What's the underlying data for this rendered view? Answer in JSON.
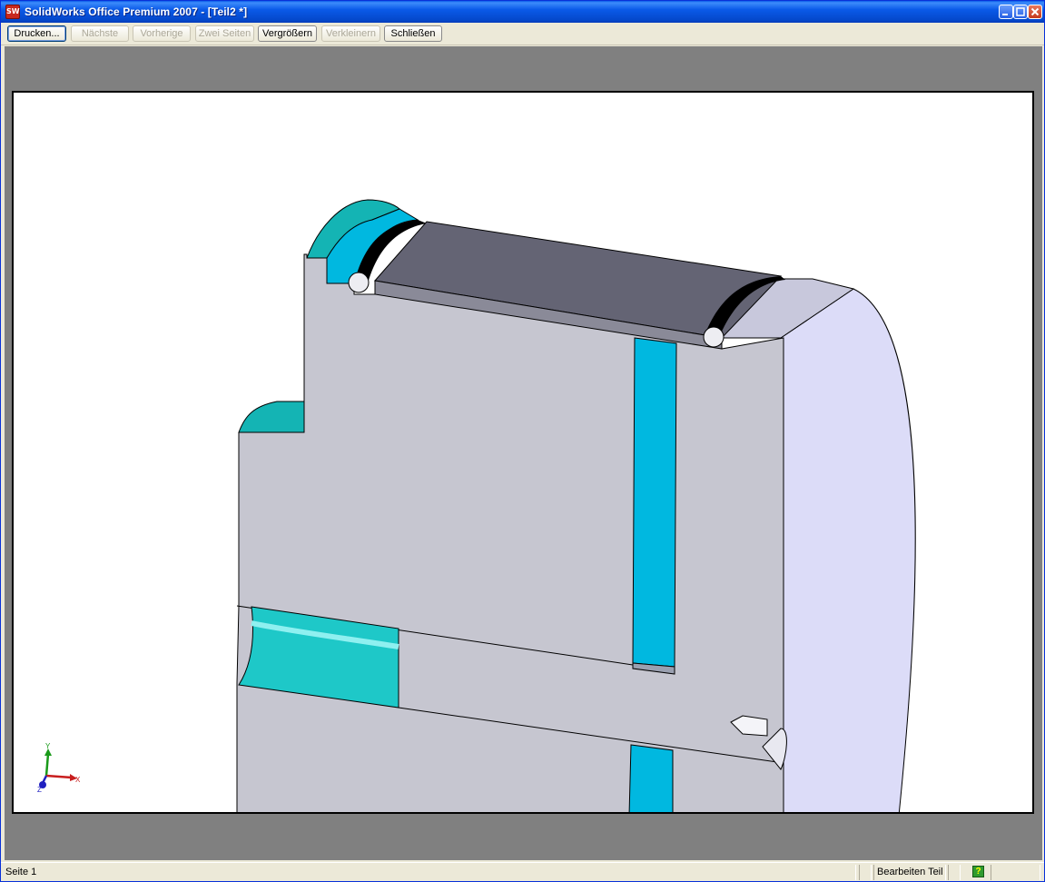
{
  "window": {
    "title": "SolidWorks Office Premium 2007 - [Teil2 *]",
    "app_icon_text": "SW"
  },
  "toolbar": {
    "buttons": [
      {
        "label": "Drucken...",
        "enabled": true,
        "focused": true
      },
      {
        "label": "Nächste",
        "enabled": false
      },
      {
        "label": "Vorherige",
        "enabled": false
      },
      {
        "label": "Zwei Seiten",
        "enabled": false
      },
      {
        "label": "Vergrößern",
        "enabled": true
      },
      {
        "label": "Verkleinern",
        "enabled": false
      },
      {
        "label": "Schließen",
        "enabled": true
      }
    ]
  },
  "triad": {
    "x_label": "X",
    "y_label": "Y",
    "z_label": "Z"
  },
  "statusbar": {
    "page": "Seite 1",
    "mode": "Bearbeiten Teil",
    "help_symbol": "?"
  },
  "colors": {
    "face_gray": "#c6c6d0",
    "face_cyan": "#00b8e0",
    "face_teal": "#14b4b4",
    "face_lavender": "#dcdcf8",
    "face_dark": "#646474"
  },
  "icons": [
    "solidworks-app-icon",
    "minimize-icon",
    "maximize-icon",
    "close-icon",
    "coordinate-triad-icon",
    "help-icon"
  ]
}
